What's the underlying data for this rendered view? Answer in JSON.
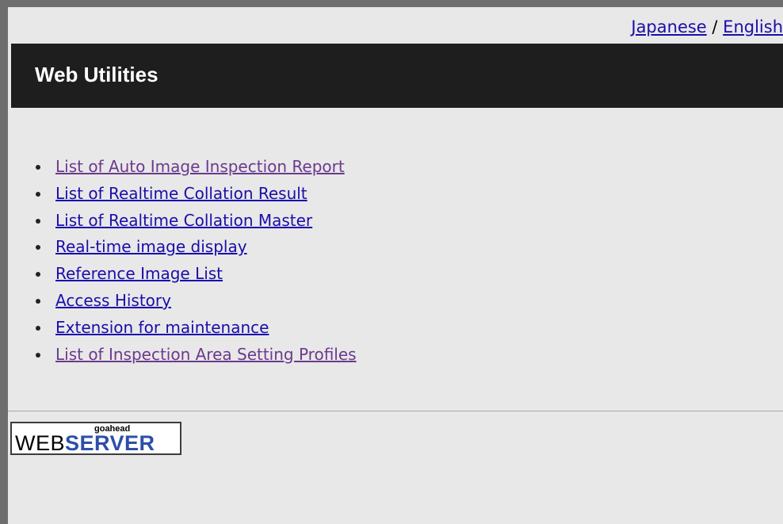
{
  "language_switch": {
    "japanese": "Japanese",
    "separator": " / ",
    "english": "English"
  },
  "header": {
    "title": "Web Utilities"
  },
  "menu": {
    "items": [
      {
        "label": "List of Auto Image Inspection Report",
        "visited": true
      },
      {
        "label": "List of Realtime Collation Result",
        "visited": false
      },
      {
        "label": "List of Realtime Collation Master",
        "visited": false
      },
      {
        "label": "Real-time image display",
        "visited": false
      },
      {
        "label": "Reference Image List",
        "visited": false
      },
      {
        "label": "Access History",
        "visited": false
      },
      {
        "label": "Extension for maintenance",
        "visited": false
      },
      {
        "label": "List of Inspection Area Setting Profiles",
        "visited": true
      }
    ]
  },
  "footer_badge": {
    "small_text": "goahead",
    "main_text_part1": "WEB",
    "main_text_part2": "SERVER"
  },
  "colors": {
    "link": "#1a0dab",
    "link_visited": "#6b3a8e",
    "header_bg": "#1e1e1e",
    "page_bg": "#e8e8e8",
    "badge_blue": "#2d4fa8"
  }
}
